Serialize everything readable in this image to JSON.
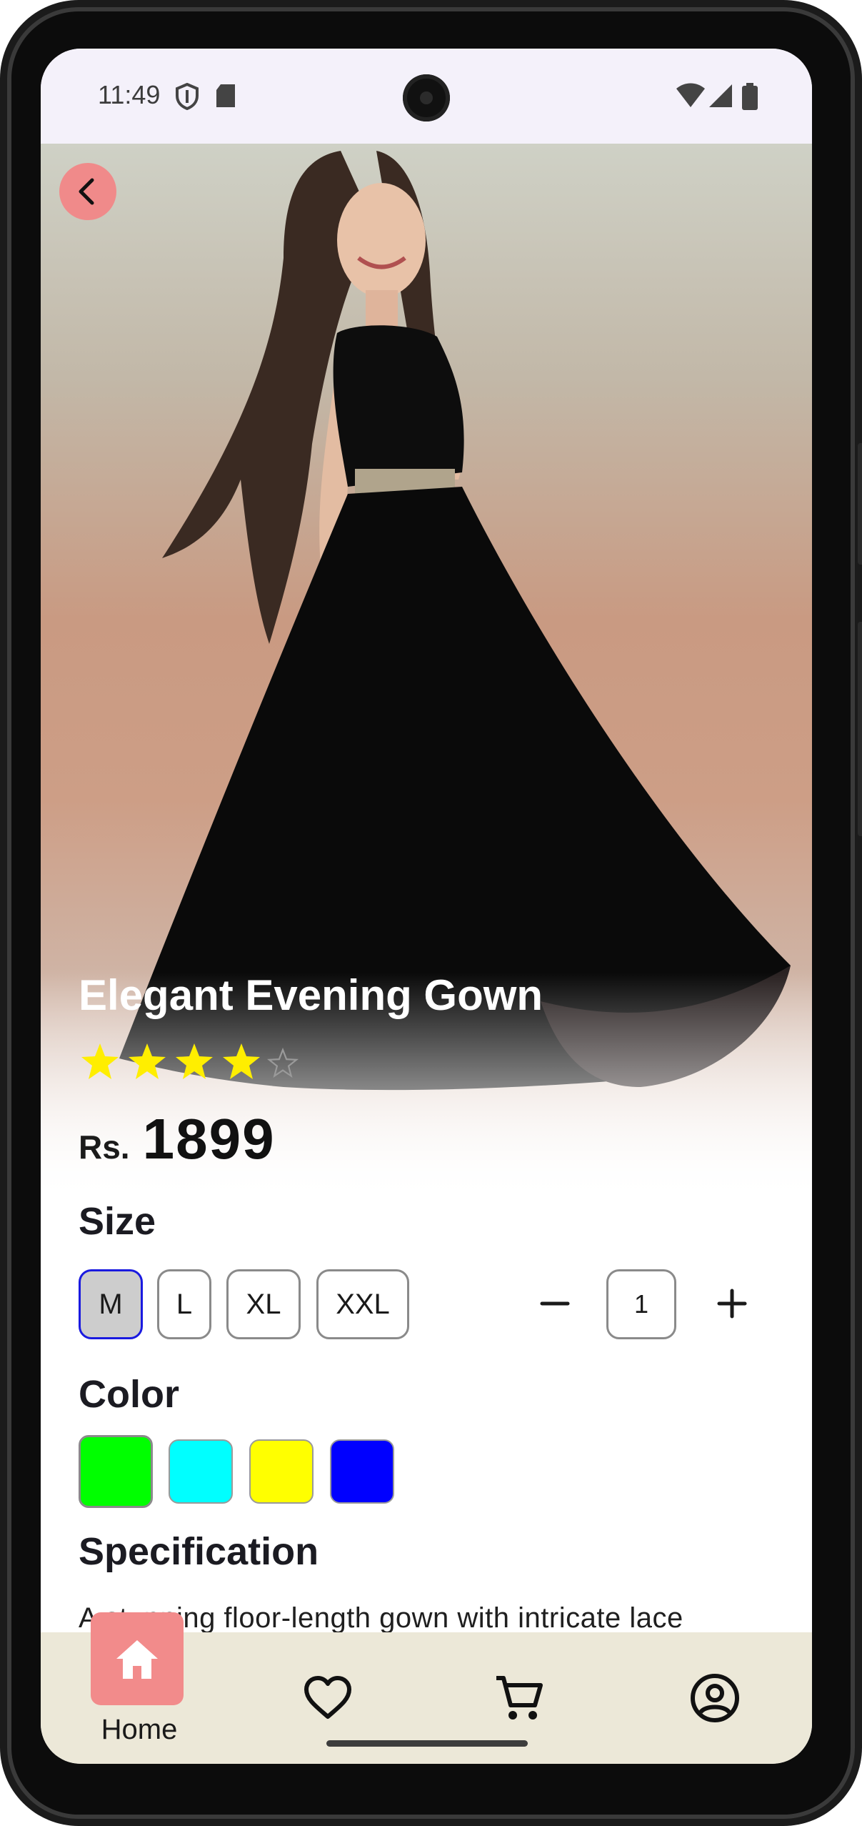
{
  "status_bar": {
    "time": "11:49",
    "icons": [
      "shield-icon",
      "sd-card-icon",
      "wifi-icon",
      "signal-icon",
      "battery-icon"
    ]
  },
  "product": {
    "name": "Elegant Evening Gown",
    "rating": 4,
    "rating_max": 5,
    "currency": "Rs.",
    "price": "1899"
  },
  "size_section": {
    "label": "Size",
    "options": [
      "M",
      "L",
      "XL",
      "XXL"
    ],
    "selected": "M"
  },
  "quantity": {
    "value": "1",
    "decrement_icon": "minus-icon",
    "increment_icon": "plus-icon"
  },
  "color_section": {
    "label": "Color",
    "options": [
      "#00ff00",
      "#00ffff",
      "#ffff00",
      "#0000ff"
    ],
    "selected": "#00ff00"
  },
  "specification": {
    "label": "Specification",
    "text": "A stunning floor-length gown with intricate lace"
  },
  "bottom_nav": {
    "items": [
      {
        "label": "Home",
        "icon": "home-icon",
        "active": true
      },
      {
        "label": "",
        "icon": "heart-icon",
        "active": false
      },
      {
        "label": "",
        "icon": "cart-icon",
        "active": false
      },
      {
        "label": "",
        "icon": "account-icon",
        "active": false
      }
    ]
  },
  "colors": {
    "accent": "#f28b8b",
    "nav_background": "#ece8d8",
    "selected_border": "#1a1ae0",
    "star": "#ffee00"
  }
}
